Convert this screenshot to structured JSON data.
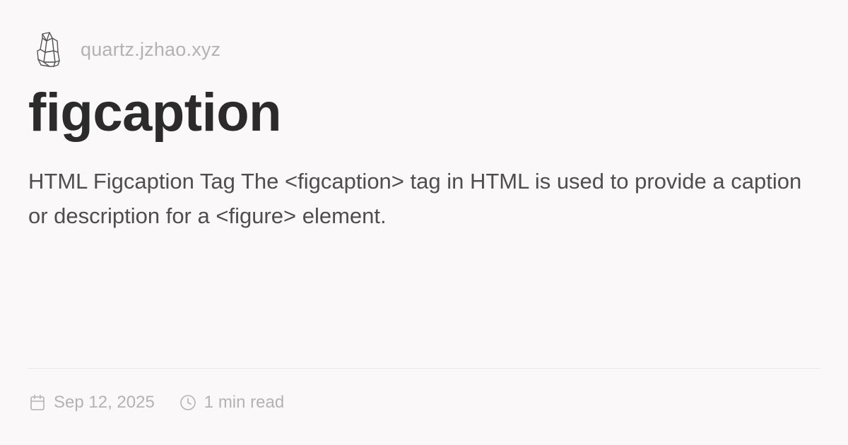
{
  "header": {
    "logo_icon": "quartz-crystal-icon",
    "site_url": "quartz.jzhao.xyz"
  },
  "page": {
    "title": "figcaption",
    "description": "HTML Figcaption Tag The <figcaption> tag in HTML is used to provide a caption or description for a <figure> element."
  },
  "meta": {
    "date_icon": "calendar-icon",
    "date": "Sep 12, 2025",
    "read_icon": "clock-icon",
    "read_time": "1 min read"
  },
  "colors": {
    "background": "#faf8f8",
    "title": "#2b2b2b",
    "body_text": "#4e4e4e",
    "muted": "#b3b3b3",
    "divider": "#e8e6e6"
  }
}
